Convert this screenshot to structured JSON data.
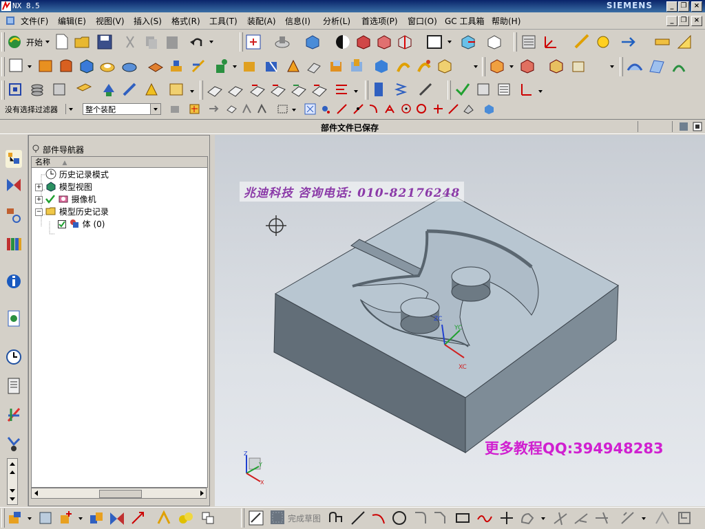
{
  "window": {
    "title": "NX 8.5",
    "brand": "SIEMENS",
    "controls": [
      "_",
      "❐",
      "×"
    ]
  },
  "menubar": {
    "items": [
      "文件(F)",
      "编辑(E)",
      "视图(V)",
      "插入(S)",
      "格式(R)",
      "工具(T)",
      "装配(A)",
      "信息(I)",
      "分析(L)",
      "首选项(P)",
      "窗口(O)",
      "GC 工具箱",
      "帮助(H)"
    ],
    "doc_controls": [
      "_",
      "❐",
      "×"
    ]
  },
  "toolbar": {
    "start_label": "开始"
  },
  "selection": {
    "filter_value": "没有选择过滤器",
    "scope_value": "整个装配"
  },
  "status": {
    "message": "部件文件已保存"
  },
  "navigator": {
    "title": "部件导航器",
    "column_header": "名称",
    "nodes": [
      {
        "label": "历史记录模式",
        "icon": "clock-icon"
      },
      {
        "label": "模型视图",
        "icon": "model-views-icon"
      },
      {
        "label": "摄像机",
        "icon": "camera-icon"
      },
      {
        "label": "模型历史记录",
        "icon": "folder-icon"
      },
      {
        "label": "体 (0)",
        "icon": "body-icon"
      }
    ]
  },
  "viewport": {
    "watermark_top": "兆迪科技 咨询电话: 010-82176248",
    "watermark_bottom": "更多教程QQ:394948283",
    "axis_labels": {
      "zc": "ZC",
      "yc": "YC",
      "xc": "XC",
      "z": "Z",
      "y": "Y",
      "x": "X"
    }
  },
  "bottom_toolbar": {
    "finish_sketch_label": "完成草图"
  },
  "colors": {
    "titlebar": "#0a246a",
    "face": "#d4d0c8",
    "part_top": "#b6c4cf",
    "part_front": "#63707a",
    "part_side": "#7d8b96",
    "watermark_purple": "#d020d0"
  }
}
